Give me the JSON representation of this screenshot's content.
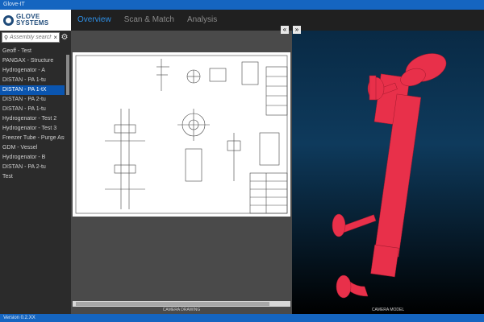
{
  "window": {
    "title": "Glove-IT"
  },
  "brand": {
    "line1": "GLOVE",
    "line2": "SYSTEMS"
  },
  "tabs": [
    {
      "label": "Overview",
      "active": true
    },
    {
      "label": "Scan & Match",
      "active": false
    },
    {
      "label": "Analysis",
      "active": false
    }
  ],
  "search": {
    "placeholder": "Assembly search",
    "value": ""
  },
  "assemblies": [
    {
      "label": "Geoff - Test",
      "selected": false
    },
    {
      "label": "PANGAX - Structure",
      "selected": false
    },
    {
      "label": "Hydrogenator - A",
      "selected": false
    },
    {
      "label": "DISTAN - PA 1-tu",
      "selected": false
    },
    {
      "label": "DISTAN - PA 1-tX",
      "selected": true
    },
    {
      "label": "DISTAN - PA 2-tu",
      "selected": false
    },
    {
      "label": "DISTAN - PA 1-tu",
      "selected": false
    },
    {
      "label": "Hydrogenator - Test 2",
      "selected": false
    },
    {
      "label": "Hydrogenator - Test 3",
      "selected": false
    },
    {
      "label": "Freezer Tube - Purge Assem",
      "selected": false
    },
    {
      "label": "GDM - Vessel",
      "selected": false
    },
    {
      "label": "Hydrogenator - B",
      "selected": false
    },
    {
      "label": "DISTAN - PA 2-tu",
      "selected": false
    },
    {
      "label": "Test",
      "selected": false
    }
  ],
  "panes": {
    "collapse_left": "«",
    "collapse_right": "»",
    "drawing_caption": "CAMERA DRAWING",
    "model_caption": "CAMERA MODEL"
  },
  "status": {
    "text": "Version 0.2.XX"
  },
  "colors": {
    "accent": "#1565c0",
    "tab_active": "#2e8fe6",
    "model": "#e8304a",
    "selection": "#0a55b0"
  },
  "icons": {
    "search": "magnifier-icon",
    "clear": "close-icon",
    "settings": "gear-icon"
  }
}
